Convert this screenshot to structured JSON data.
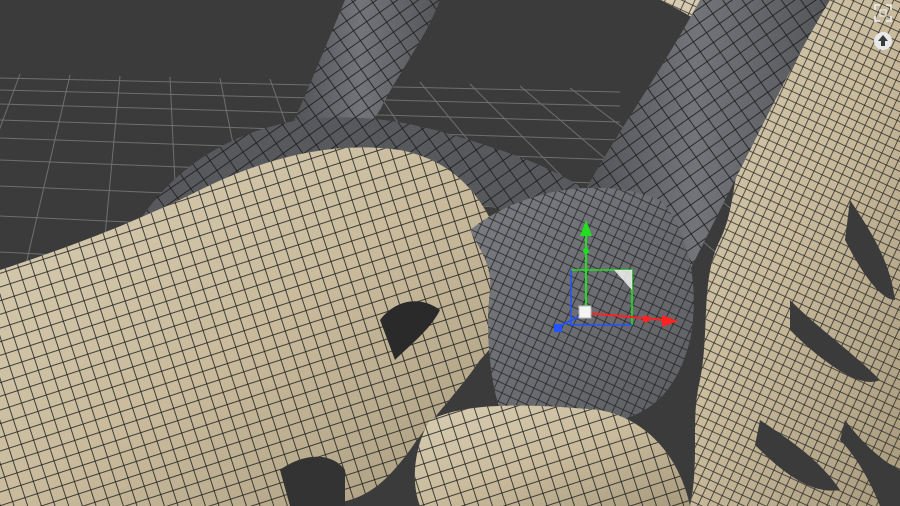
{
  "viewport": {
    "mode": "perspective",
    "shading": "textured-wireframe",
    "background_color": "#3b3b3b",
    "grid_color": "#6d6d6d",
    "mesh_wire_color": "#1d1d1d",
    "skin_color": "#cdbfa3",
    "selection_color": "#6a6c70"
  },
  "gizmo": {
    "type": "move",
    "axes": [
      {
        "name": "x",
        "color": "#ff2222"
      },
      {
        "name": "y",
        "color": "#22dd22"
      },
      {
        "name": "z",
        "color": "#2255ff"
      }
    ]
  },
  "corner_controls": {
    "maximize_icon": "maximize-frame-icon",
    "up_icon": "up-arrow-icon"
  }
}
